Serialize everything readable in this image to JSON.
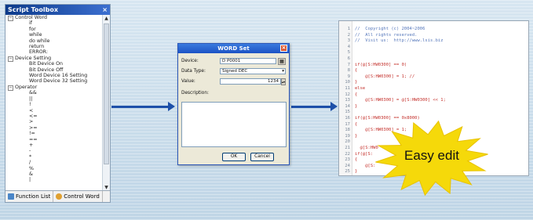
{
  "toolbox": {
    "title": "Script Toolbox",
    "close_glyph": "×",
    "groups": [
      {
        "label": "Control Word",
        "toggle": "−",
        "items": [
          "if",
          "for",
          "while",
          "do while",
          "return",
          "ERROR:"
        ]
      },
      {
        "label": "Device Setting",
        "toggle": "−",
        "items": [
          "Bit Device On",
          "Bit Device Off",
          "Word Device 16 Setting",
          "Word Device 32 Setting"
        ]
      },
      {
        "label": "Operator",
        "toggle": "−",
        "items": [
          "&&",
          "||",
          "!",
          "<",
          "<=",
          ">",
          ">=",
          "!=",
          "==",
          "+",
          "-",
          "*",
          "/",
          "%",
          "&",
          "|"
        ]
      }
    ],
    "tabs": [
      {
        "label": "Function List",
        "icon": "function-list-icon"
      },
      {
        "label": "Control Word",
        "icon": "control-word-icon"
      }
    ],
    "scroll_up": "▲",
    "scroll_down": "▼"
  },
  "dialog": {
    "title": "WORD Set",
    "close_glyph": "×",
    "device_label": "Device:",
    "device_value": "D  P0001",
    "data_type_label": "Data Type:",
    "data_type_value": "Signed DEC",
    "value_label": "Value:",
    "value_value": "1234",
    "description_label": "Description:",
    "ok_label": "OK",
    "cancel_label": "Cancel"
  },
  "editor": {
    "lines": [
      {
        "n": "1",
        "text": "//  Copyright (c) 2004~2006",
        "cls": "cm"
      },
      {
        "n": "2",
        "text": "//  All rights reserved.",
        "cls": "cm"
      },
      {
        "n": "3",
        "text": "//  Visit us:  http://www.lsis.biz",
        "cls": "cm"
      },
      {
        "n": "4",
        "text": "",
        "cls": ""
      },
      {
        "n": "5",
        "text": "",
        "cls": ""
      },
      {
        "n": "6",
        "text": "",
        "cls": ""
      },
      {
        "n": "7",
        "text": "if(@[S:HW0300] == 0)",
        "cls": ""
      },
      {
        "n": "8",
        "text": "{",
        "cls": ""
      },
      {
        "n": "9",
        "text": "    @[S:HW0300] = 1; //",
        "cls": ""
      },
      {
        "n": "10",
        "text": "}",
        "cls": ""
      },
      {
        "n": "11",
        "text": "else",
        "cls": ""
      },
      {
        "n": "12",
        "text": "{",
        "cls": ""
      },
      {
        "n": "13",
        "text": "    @[S:HW0300] = @[S:HW0300] << 1;",
        "cls": ""
      },
      {
        "n": "14",
        "text": "}",
        "cls": ""
      },
      {
        "n": "15",
        "text": "",
        "cls": ""
      },
      {
        "n": "16",
        "text": "if(@[S:HW0300] == 0x8000)",
        "cls": ""
      },
      {
        "n": "17",
        "text": "{",
        "cls": ""
      },
      {
        "n": "18",
        "text": "    @[S:HW0300] = 1;",
        "cls": ""
      },
      {
        "n": "19",
        "text": "}",
        "cls": ""
      },
      {
        "n": "20",
        "text": "",
        "cls": ""
      },
      {
        "n": "21",
        "text": "  @[S:HW0",
        "cls": ""
      },
      {
        "n": "22",
        "text": "if(@[S:",
        "cls": ""
      },
      {
        "n": "23",
        "text": "{",
        "cls": ""
      },
      {
        "n": "24",
        "text": "    @[S:",
        "cls": ""
      },
      {
        "n": "25",
        "text": "}",
        "cls": ""
      }
    ]
  },
  "callout": {
    "text": "Easy edit",
    "color": "#f5d90a",
    "edge_color": "#e8c200"
  },
  "colors": {
    "arrow": "#1d4fa8",
    "title_bar": "#0c3a8a"
  }
}
